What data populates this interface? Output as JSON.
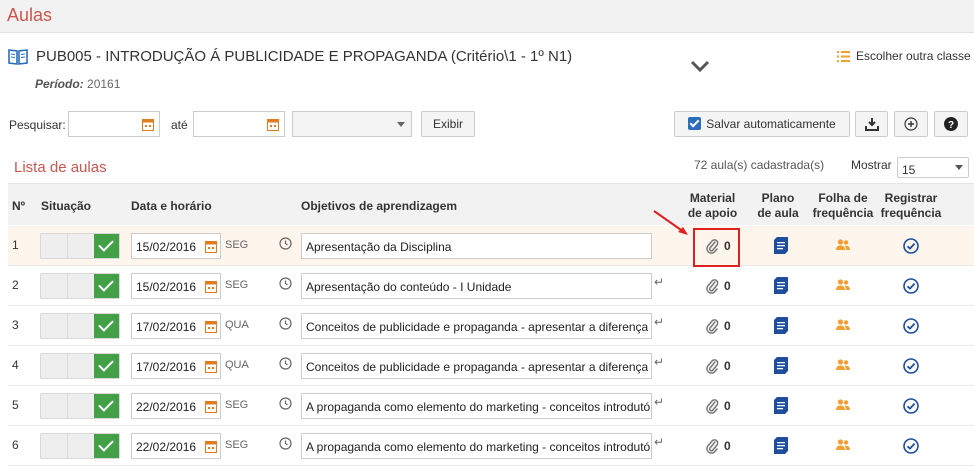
{
  "page": {
    "title": "Aulas"
  },
  "course": {
    "name": "PUB005 - INTRODUÇÃO Á PUBLICIDADE E PROPAGANDA (Critério\\1 - 1º N1)",
    "period_label": "Período:",
    "period_value": "20161",
    "other_class": "Escolher outra classe"
  },
  "filters": {
    "search_label": "Pesquisar:",
    "until_label": "até",
    "show_button": "Exibir",
    "autosave_label": "Salvar automaticamente"
  },
  "list": {
    "title": "Lista de aulas",
    "count_text": "72 aula(s) cadastrada(s)",
    "show_label": "Mostrar",
    "page_size": "15"
  },
  "table": {
    "headers": {
      "num": "Nº",
      "status": "Situação",
      "datetime": "Data e horário",
      "objectives": "Objetivos de aprendizagem",
      "material_1": "Material",
      "material_2": "de apoio",
      "plan_1": "Plano",
      "plan_2": "de aula",
      "attendance_sheet_1": "Folha de",
      "attendance_sheet_2": "frequência",
      "register_1": "Registrar",
      "register_2": "frequência"
    },
    "rows": [
      {
        "num": "1",
        "date": "15/02/2016",
        "day": "SEG",
        "objective": "Apresentação da Disciplina",
        "material_count": "0"
      },
      {
        "num": "2",
        "date": "15/02/2016",
        "day": "SEG",
        "objective": "Apresentação do conteúdo - I Unidade",
        "material_count": "0"
      },
      {
        "num": "3",
        "date": "17/02/2016",
        "day": "QUA",
        "objective": "Conceitos de publicidade e propaganda - apresentar a diferença",
        "material_count": "0"
      },
      {
        "num": "4",
        "date": "17/02/2016",
        "day": "QUA",
        "objective": "Conceitos de publicidade e propaganda - apresentar a diferença",
        "material_count": "0"
      },
      {
        "num": "5",
        "date": "22/02/2016",
        "day": "SEG",
        "objective": "A propaganda como elemento do marketing - conceitos introdutórios",
        "material_count": "0"
      },
      {
        "num": "6",
        "date": "22/02/2016",
        "day": "SEG",
        "objective": "A propaganda como elemento do marketing - conceitos introdutórios",
        "material_count": "0"
      }
    ]
  },
  "colors": {
    "accent_red": "#c9574f",
    "toggle_green": "#43a047",
    "doc_blue": "#1f4e9c",
    "people_orange": "#f0a030",
    "highlight_red": "#e02020"
  }
}
